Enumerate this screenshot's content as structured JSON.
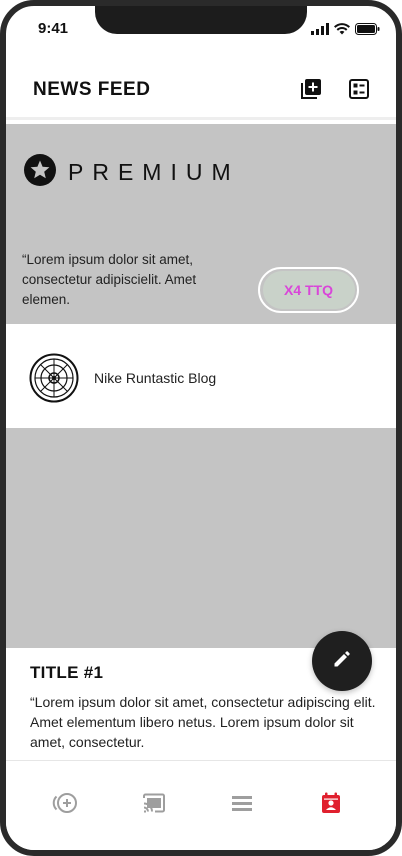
{
  "status_bar": {
    "time": "9:41"
  },
  "header": {
    "title": "NEWS FEED"
  },
  "premium": {
    "label": "PREMIUM",
    "text": "“Lorem ipsum dolor sit amet, consectetur adipiscielit. Amet elemen.",
    "button_label": "X4 TTQ",
    "button_text_color": "#d946d9"
  },
  "blog": {
    "name": "Nike Runtastic Blog"
  },
  "post": {
    "title": "TITLE #1",
    "body": "“Lorem ipsum dolor sit amet, consectetur adipiscing elit. Amet elementum libero netus. Lorem ipsum dolor sit amet, consectetur."
  },
  "tabbar": {
    "items": [
      {
        "icon": "add-circle-icon",
        "active": false
      },
      {
        "icon": "cast-icon",
        "active": false
      },
      {
        "icon": "list-icon",
        "active": false
      },
      {
        "icon": "calendar-person-icon",
        "active": true
      }
    ],
    "active_color": "#e0202e",
    "inactive_color": "#9e9e9e"
  },
  "colors": {
    "placeholder_gray": "#c4c4c4",
    "fab": "#1f1f1f"
  }
}
